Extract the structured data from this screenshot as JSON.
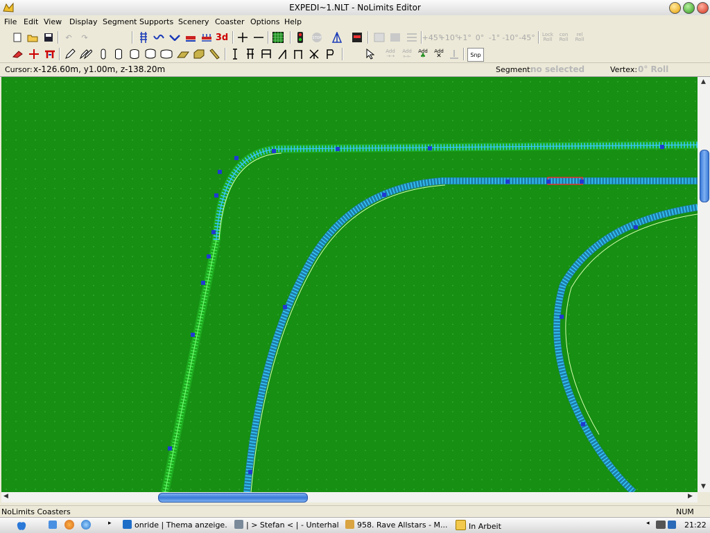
{
  "window": {
    "title": "EXPEDI~1.NLT - NoLimits Editor"
  },
  "menu": [
    "File",
    "Edit",
    "View",
    "Display",
    "Segment",
    "Supports",
    "Scenery",
    "Coaster",
    "Options",
    "Help"
  ],
  "toolbar1": {
    "btn_3d": "3d",
    "angles": [
      "+45°",
      "+10°",
      "+1°",
      "0°",
      "-1°",
      "-10°",
      "-45°"
    ],
    "lock_roll": "Lock Roll",
    "con_roll": "con Roll",
    "rel_roll": "rel Roll"
  },
  "toolbar2": {
    "add1": "Add",
    "add2": "Add",
    "add3": "Add",
    "add4": "Add",
    "snp": "Snp"
  },
  "cursor": {
    "label": "Cursor:",
    "value": "x-126.60m, y1.00m, z-138.20m",
    "segment_label": "Segment:",
    "segment_value": "no selected",
    "vertex_label": "Vertex:",
    "vertex_value": "0° Roll"
  },
  "status": {
    "text": "NoLimits Coasters",
    "num": "NUM"
  },
  "taskbar": {
    "tasks": [
      "onride | Thema anzeige...",
      "| > Stefan < | - Unterhal...",
      "958. Rave Allstars - M...",
      "In Arbeit"
    ],
    "clock": "21:22"
  },
  "colors": {
    "ground": "#168f13",
    "track": "#35c9ff",
    "track_selected_green": "#39e03a",
    "vertex": "#1f3ad0"
  }
}
